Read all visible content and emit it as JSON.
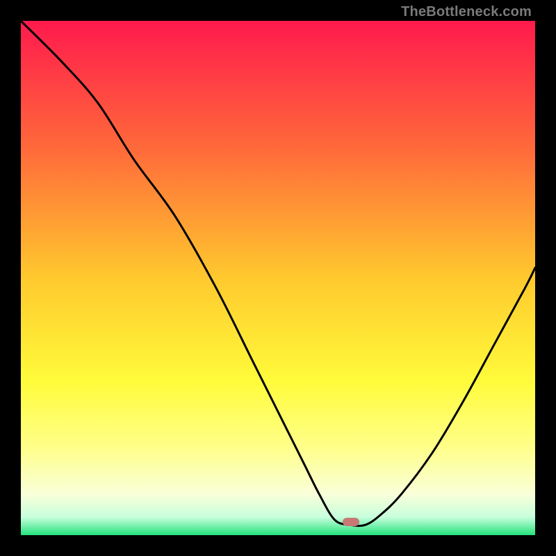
{
  "watermark": "TheBottleneck.com",
  "colors": {
    "gradient_stops": [
      {
        "pos": 0.0,
        "color": "#ff1a4d"
      },
      {
        "pos": 0.25,
        "color": "#ff6a3a"
      },
      {
        "pos": 0.5,
        "color": "#ffc92e"
      },
      {
        "pos": 0.7,
        "color": "#fffb3a"
      },
      {
        "pos": 0.83,
        "color": "#ffff8a"
      },
      {
        "pos": 0.92,
        "color": "#f9ffd9"
      },
      {
        "pos": 0.965,
        "color": "#c8ffdc"
      },
      {
        "pos": 1.0,
        "color": "#23e27c"
      }
    ],
    "curve": "#000000",
    "marker": "#c77975",
    "frame": "#000000"
  },
  "marker": {
    "x_frac": 0.642,
    "y_frac": 0.974
  },
  "chart_data": {
    "type": "line",
    "title": "",
    "xlabel": "",
    "ylabel": "",
    "xlim": [
      0,
      100
    ],
    "ylim": [
      0,
      100
    ],
    "grid": false,
    "legend": false,
    "series": [
      {
        "name": "bottleneck-curve",
        "x": [
          0,
          8,
          15,
          22,
          30,
          38,
          45,
          50,
          55,
          58,
          61,
          64,
          67,
          70,
          74,
          80,
          86,
          92,
          98,
          100
        ],
        "y": [
          100,
          92,
          84,
          73,
          62,
          48,
          34,
          24,
          14,
          8,
          3,
          2,
          2,
          4,
          8,
          16,
          26,
          37,
          48,
          52
        ]
      }
    ],
    "annotations": [
      {
        "type": "marker",
        "x": 64.2,
        "y": 2.6,
        "label": "optimal-point"
      }
    ]
  }
}
